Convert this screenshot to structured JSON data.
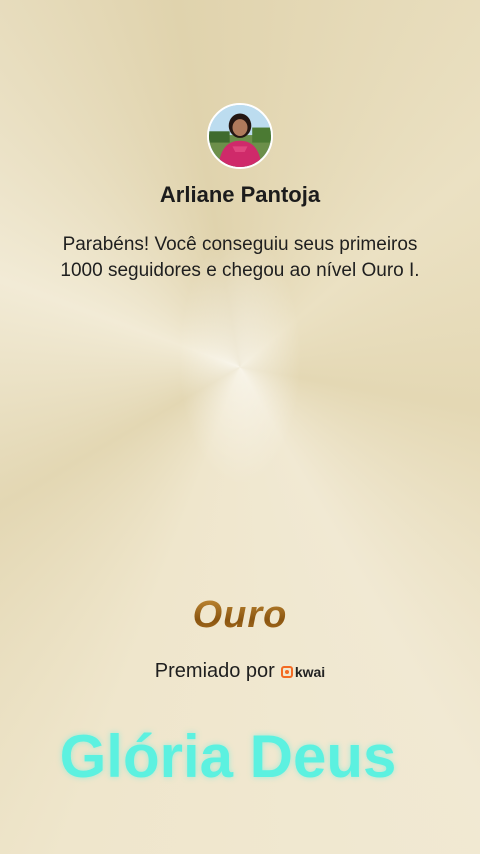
{
  "user": {
    "name": "Arliane Pantoja",
    "avatar_icon": "profile-photo"
  },
  "message": "Parabéns! Você conseguiu seus primeiros 1000 seguidores e chegou ao nível Ouro I.",
  "level": {
    "title": "Ouro",
    "color": "#a66a16"
  },
  "awarded": {
    "label": "Premiado por",
    "brand": "kwai",
    "brand_color": "#f36a22"
  },
  "overlay": {
    "text": "Glória Deus",
    "color": "#5cf1e0"
  }
}
